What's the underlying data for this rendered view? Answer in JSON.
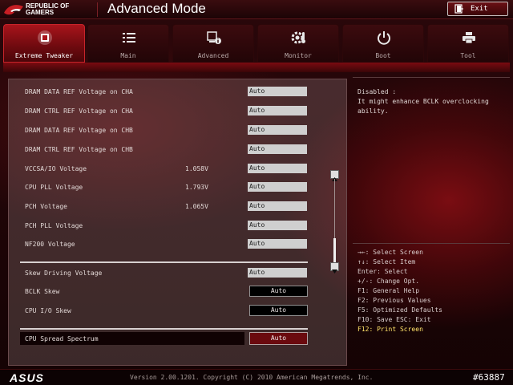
{
  "header": {
    "brand_line1": "REPUBLIC OF",
    "brand_line2": "GAMERS",
    "title": "Advanced Mode",
    "exit_label": "Exit"
  },
  "tabs": [
    {
      "label": "Extreme Tweaker",
      "icon": "tweaker-chip-icon",
      "active": true
    },
    {
      "label": "Main",
      "icon": "list-icon",
      "active": false
    },
    {
      "label": "Advanced",
      "icon": "advanced-info-icon",
      "active": false
    },
    {
      "label": "Monitor",
      "icon": "gear-thermometer-icon",
      "active": false
    },
    {
      "label": "Boot",
      "icon": "power-icon",
      "active": false
    },
    {
      "label": "Tool",
      "icon": "printer-icon",
      "active": false
    }
  ],
  "settings": [
    {
      "label": "DRAM DATA REF Voltage on CHA",
      "reading": "",
      "value": "Auto"
    },
    {
      "label": "DRAM CTRL REF Voltage on CHA",
      "reading": "",
      "value": "Auto"
    },
    {
      "label": "DRAM DATA REF Voltage on CHB",
      "reading": "",
      "value": "Auto"
    },
    {
      "label": "DRAM CTRL REF Voltage on CHB",
      "reading": "",
      "value": "Auto"
    },
    {
      "label": "VCCSA/IO Voltage",
      "reading": "1.058V",
      "value": "Auto"
    },
    {
      "label": "CPU PLL Voltage",
      "reading": "1.793V",
      "value": "Auto"
    },
    {
      "label": "PCH Voltage",
      "reading": "1.065V",
      "value": "Auto"
    },
    {
      "label": "PCH PLL Voltage",
      "reading": "",
      "value": "Auto"
    },
    {
      "label": "NF200 Voltage",
      "reading": "",
      "value": "Auto"
    }
  ],
  "skew": {
    "driving_label": "Skew Driving Voltage",
    "driving_value": "Auto",
    "bclk_label": "BCLK Skew",
    "bclk_value": "Auto",
    "cpuio_label": "CPU I/O Skew",
    "cpuio_value": "Auto"
  },
  "spread": {
    "label": "CPU Spread Spectrum",
    "value": "Auto"
  },
  "help": {
    "line1": "Disabled :",
    "line2": "It might enhance BCLK overclocking",
    "line3": "ability."
  },
  "keys": [
    "→←: Select Screen",
    "↑↓: Select Item",
    "Enter: Select",
    "+/-: Change Opt.",
    "F1: General Help",
    "F2: Previous Values",
    "F5: Optimized Defaults",
    "F10: Save  ESC: Exit",
    "F12: Print Screen"
  ],
  "footer": {
    "brand": "ASUS",
    "version": "Version 2.00.1201. Copyright (C) 2010 American Megatrends, Inc.",
    "badge": "#63887"
  },
  "colors": {
    "accent_red": "#a8141b",
    "highlight_key": "#ffe36a"
  }
}
